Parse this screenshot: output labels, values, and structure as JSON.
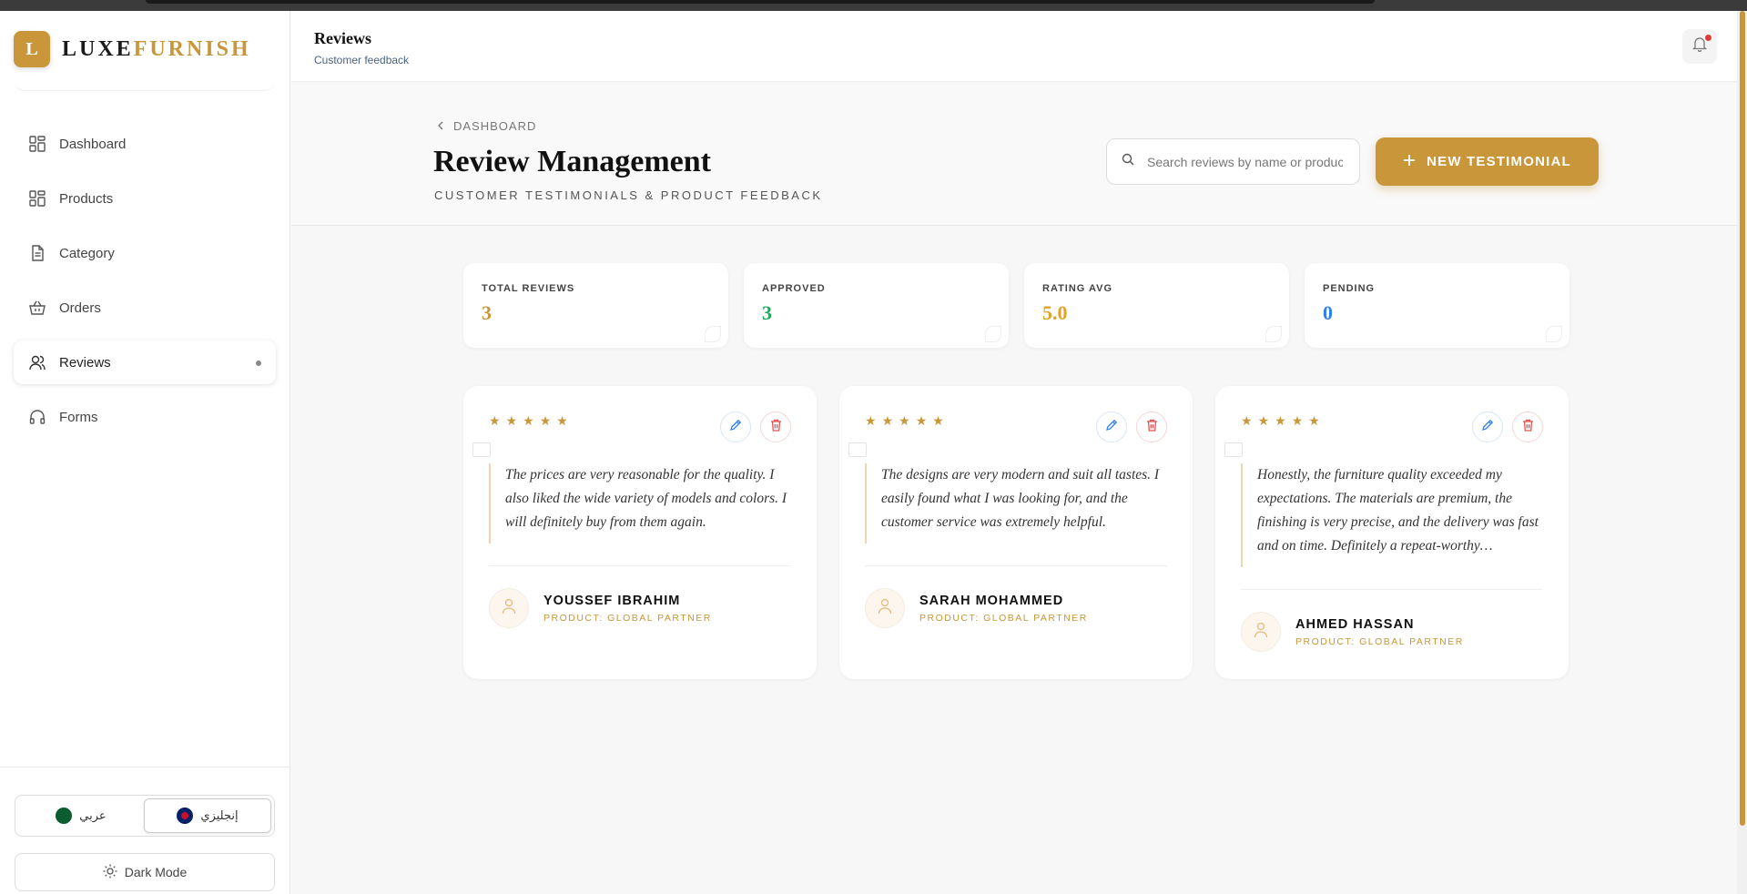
{
  "brand": {
    "initial": "L",
    "name_part1": "LUXE",
    "name_part2": "FURNISH",
    "accent_color": "#c9963a"
  },
  "sidebar": {
    "items": [
      {
        "label": "Dashboard",
        "icon": "grid-icon"
      },
      {
        "label": "Products",
        "icon": "grid-icon"
      },
      {
        "label": "Category",
        "icon": "document-icon"
      },
      {
        "label": "Orders",
        "icon": "basket-icon"
      },
      {
        "label": "Reviews",
        "icon": "users-icon",
        "active": true
      },
      {
        "label": "Forms",
        "icon": "headphones-icon"
      }
    ],
    "lang_ar": "عربي",
    "lang_en": "إنجليزي",
    "dark_mode": "Dark Mode"
  },
  "header": {
    "title": "Reviews",
    "subtitle": "Customer feedback"
  },
  "page": {
    "breadcrumb": "DASHBOARD",
    "title": "Review Management",
    "subtitle": "CUSTOMER TESTIMONIALS & PRODUCT FEEDBACK",
    "search_placeholder": "Search reviews by name or product...",
    "new_button": "NEW TESTIMONIAL"
  },
  "stats": [
    {
      "label": "TOTAL REVIEWS",
      "value": "3",
      "color": "#c9963a"
    },
    {
      "label": "APPROVED",
      "value": "3",
      "color": "#1faa59"
    },
    {
      "label": "RATING AVG",
      "value": "5.0",
      "color": "#e0a520"
    },
    {
      "label": "PENDING",
      "value": "0",
      "color": "#2f80ed"
    }
  ],
  "reviews": [
    {
      "rating": 5,
      "text": "The prices are very reasonable for the quality. I also liked the wide variety of models and colors. I will definitely buy from them again.",
      "name": "YOUSSEF IBRAHIM",
      "product": "PRODUCT: GLOBAL PARTNER"
    },
    {
      "rating": 5,
      "text": "The designs are very modern and suit all tastes. I easily found what I was looking for, and the customer service was extremely helpful.",
      "name": "SARAH MOHAMMED",
      "product": "PRODUCT: GLOBAL PARTNER"
    },
    {
      "rating": 5,
      "text": "Honestly, the furniture quality exceeded my expectations. The materials are premium, the finishing is very precise, and the delivery was fast and on time. Definitely a repeat-worthy…",
      "name": "AHMED HASSAN",
      "product": "PRODUCT: GLOBAL PARTNER"
    }
  ]
}
